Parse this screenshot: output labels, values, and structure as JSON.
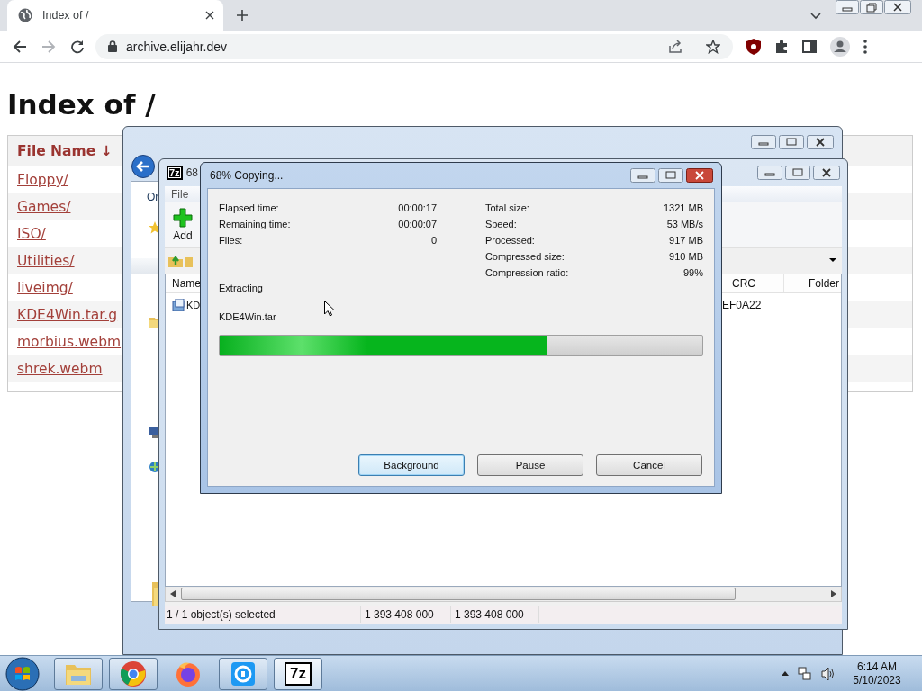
{
  "browser": {
    "tab": {
      "title": "Index of /",
      "selected": true
    },
    "address": "archive.elijahr.dev"
  },
  "page": {
    "heading": "Index of /",
    "table": {
      "columns": [
        "File Name ↓"
      ],
      "rows": [
        {
          "name": "Floppy/"
        },
        {
          "name": "Games/"
        },
        {
          "name": "ISO/"
        },
        {
          "name": "Utilities/"
        },
        {
          "name": "liveimg/"
        },
        {
          "name": "KDE4Win.tar.g"
        },
        {
          "name": "morbius.webm"
        },
        {
          "name": "shrek.webm"
        }
      ]
    }
  },
  "explorer_window": {
    "toolbar_label": "Or"
  },
  "archive_window": {
    "logo": "7z",
    "title": "68",
    "menu": [
      "File"
    ],
    "toolbar": [
      "Add"
    ],
    "columns": [
      "Name",
      "CRC",
      "Folder"
    ],
    "rows": [
      {
        "name": "KD",
        "crc": "EF0A22"
      }
    ],
    "status_bar": [
      "1 / 1 object(s) selected",
      "1 393 408 000",
      "1 393 408 000"
    ]
  },
  "progress_dialog": {
    "title": "68% Copying...",
    "left_stats": [
      {
        "label": "Elapsed time:",
        "value": "00:00:17"
      },
      {
        "label": "Remaining time:",
        "value": "00:00:07"
      },
      {
        "label": "Files:",
        "value": "0"
      }
    ],
    "right_stats": [
      {
        "label": "Total size:",
        "value": "1321 MB"
      },
      {
        "label": "Speed:",
        "value": "53 MB/s"
      },
      {
        "label": "Processed:",
        "value": "917 MB"
      },
      {
        "label": "Compressed size:",
        "value": "910 MB"
      },
      {
        "label": "Compression ratio:",
        "value": "99%"
      }
    ],
    "operation": "Extracting",
    "file": "KDE4Win.tar",
    "level": 0.68,
    "buttons": [
      {
        "label": "Background",
        "focused": true
      },
      {
        "label": "Pause",
        "focused": false
      },
      {
        "label": "Cancel",
        "focused": false
      }
    ]
  },
  "taskbar": {
    "apps": [
      {
        "kind": "explorer",
        "running": true,
        "selected": false
      },
      {
        "kind": "chrome",
        "running": true,
        "selected": false
      },
      {
        "kind": "firefox",
        "running": false,
        "selected": false
      },
      {
        "kind": "kde",
        "running": true,
        "selected": false
      },
      {
        "kind": "sevenzip",
        "label": "7z",
        "running": true,
        "selected": true
      }
    ],
    "time": "6:14 AM",
    "date": "5/10/2023"
  }
}
